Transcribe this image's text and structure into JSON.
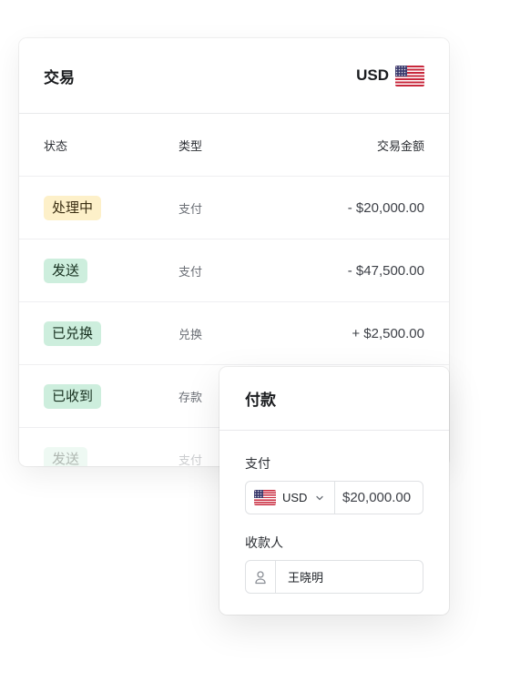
{
  "transactions": {
    "title": "交易",
    "currency": "USD",
    "columns": {
      "status": "状态",
      "type": "类型",
      "amount": "交易金额"
    },
    "rows": [
      {
        "status": "处理中",
        "type": "支付",
        "amount": "- $20,000.00",
        "badge": "amber"
      },
      {
        "status": "发送",
        "type": "支付",
        "amount": "- $47,500.00",
        "badge": "green"
      },
      {
        "status": "已兑换",
        "type": "兑换",
        "amount": "+ $2,500.00",
        "badge": "green"
      },
      {
        "status": "已收到",
        "type": "存款",
        "amount": "",
        "badge": "green"
      },
      {
        "status": "发送",
        "type": "支付",
        "amount": "",
        "badge": "green"
      }
    ]
  },
  "payment": {
    "title": "付款",
    "pay_label": "支付",
    "currency": "USD",
    "amount": "$20,000.00",
    "payee_label": "收款人",
    "payee_name": "王晓明"
  },
  "icons": {
    "flag": "us-flag-icon",
    "chevron": "chevron-down-icon",
    "user": "user-icon"
  },
  "colors": {
    "badge_amber": "#fdf0c9",
    "badge_green": "#cdeedd",
    "border": "#dfe1e4"
  }
}
